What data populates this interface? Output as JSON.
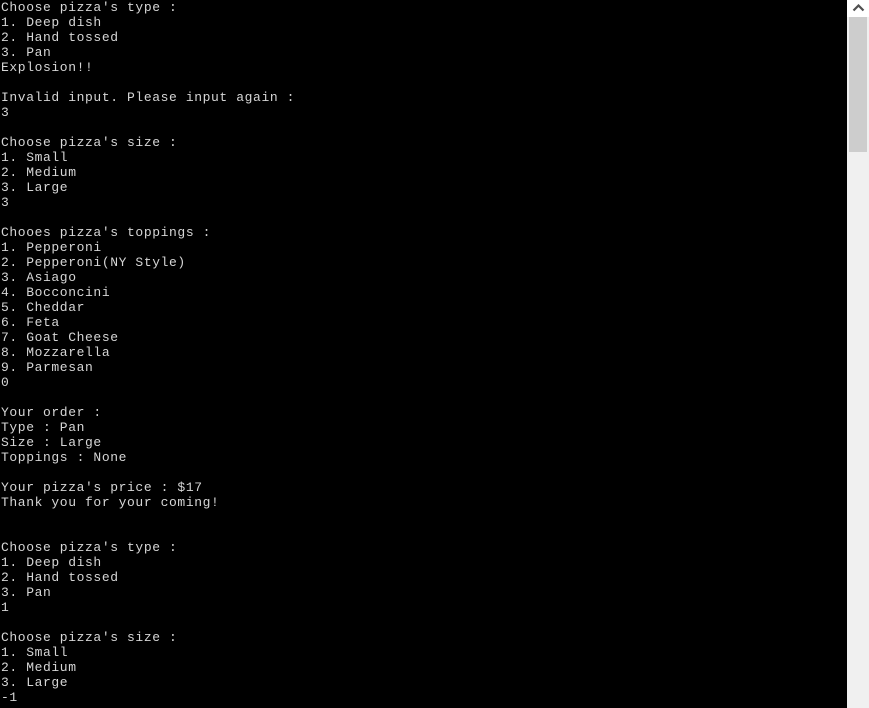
{
  "window": {
    "type": "console-terminal",
    "background_color": "#000000",
    "text_color": "#d6d6d6"
  },
  "console": {
    "lines": [
      "Choose pizza's type :",
      "1. Deep dish",
      "2. Hand tossed",
      "3. Pan",
      "Explosion!!",
      "",
      "Invalid input. Please input again :",
      "3",
      "",
      "Choose pizza's size :",
      "1. Small",
      "2. Medium",
      "3. Large",
      "3",
      "",
      "Chooes pizza's toppings :",
      "1. Pepperoni",
      "2. Pepperoni(NY Style)",
      "3. Asiago",
      "4. Bocconcini",
      "5. Cheddar",
      "6. Feta",
      "7. Goat Cheese",
      "8. Mozzarella",
      "9. Parmesan",
      "0",
      "",
      "Your order :",
      "Type : Pan",
      "Size : Large",
      "Toppings : None",
      "",
      "Your pizza's price : $17",
      "Thank you for your coming!",
      "",
      "",
      "Choose pizza's type :",
      "1. Deep dish",
      "2. Hand tossed",
      "3. Pan",
      "1",
      "",
      "Choose pizza's size :",
      "1. Small",
      "2. Medium",
      "3. Large",
      "-1"
    ]
  },
  "scrollbar": {
    "up_arrow_icon": "chevron-up-icon",
    "thumb_color": "#cdcdcd",
    "track_color": "#f0f0f0"
  }
}
